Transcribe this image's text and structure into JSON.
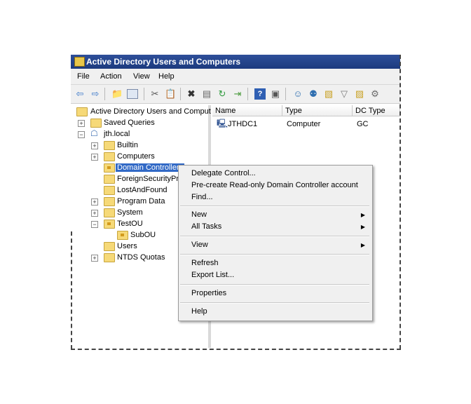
{
  "window": {
    "title": "Active Directory Users and Computers"
  },
  "menu": [
    "File",
    "Action",
    "View",
    "Help"
  ],
  "toolbar": {
    "icons": [
      "back-arrow-icon",
      "forward-arrow-icon",
      "up-folder-icon",
      "show-tree-icon",
      "cut-icon",
      "copy-icon",
      "delete-icon",
      "properties-icon",
      "refresh-icon",
      "export-icon",
      "help-icon",
      "mmc-icon",
      "add-user-icon",
      "add-group-icon",
      "add-ou-icon",
      "filter-icon",
      "find-icon",
      "delegate-icon"
    ]
  },
  "tree": {
    "root": "Active Directory Users and Comput",
    "saved_queries": "Saved Queries",
    "domain": "jth.local",
    "nodes": [
      "Builtin",
      "Computers",
      "Domain Controllers",
      "ForeignSecurityPrin",
      "LostAndFound",
      "Program Data",
      "System",
      "TestOU",
      "SubOU",
      "Users",
      "NTDS Quotas"
    ]
  },
  "list": {
    "columns": [
      "Name",
      "Type",
      "DC Type"
    ],
    "rows": [
      {
        "name": "JTHDC1",
        "type": "Computer",
        "dc_type": "GC"
      }
    ]
  },
  "context_menu": {
    "delegate": "Delegate Control...",
    "precreate": "Pre-create Read-only Domain Controller account",
    "find": "Find...",
    "new": "New",
    "all_tasks": "All Tasks",
    "view": "View",
    "refresh": "Refresh",
    "export": "Export List...",
    "properties": "Properties",
    "help": "Help"
  }
}
